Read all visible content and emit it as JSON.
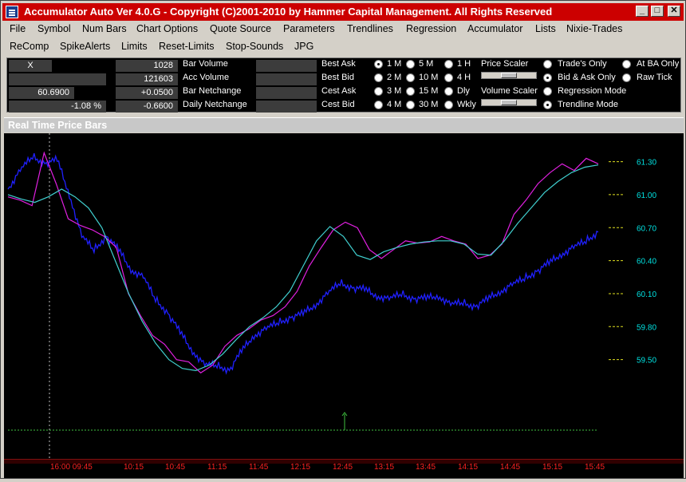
{
  "window": {
    "title": "Accumulator Auto Ver 4.0.G - Copyright (C)2001-2010 by Hammer Capital Management. All Rights Reserved"
  },
  "menu": {
    "row1": [
      "File",
      "Symbol",
      "Num Bars",
      "Chart Options",
      "Quote Source",
      "Parameters",
      "Trendlines",
      "Regression",
      "Accumulator",
      "Lists",
      "Nixie-Trades"
    ],
    "row2": [
      "ReComp",
      "SpikeAlerts",
      "Limits",
      "Reset-Limits",
      "Stop-Sounds",
      "JPG"
    ]
  },
  "panel": {
    "symbol_box": "X",
    "price_field": "60.6900",
    "pct_field": "-1.08 %",
    "bar_volume": "1028",
    "acc_volume": "121603",
    "bar_netchange": "+0.0500",
    "daily_netchange": "-0.6600",
    "labels": {
      "bar_volume": "Bar Volume",
      "acc_volume": "Acc Volume",
      "bar_netchange": "Bar Netchange",
      "daily_netchange": "Daily Netchange",
      "best_ask": "Best Ask",
      "best_bid": "Best Bid",
      "cest_ask": "Cest Ask",
      "cest_bid": "Cest Bid"
    },
    "timeframes": [
      {
        "label": "1 M",
        "selected": true
      },
      {
        "label": "5 M",
        "selected": false
      },
      {
        "label": "1 H",
        "selected": false
      },
      {
        "label": "2 M",
        "selected": false
      },
      {
        "label": "10 M",
        "selected": false
      },
      {
        "label": "4 H",
        "selected": false
      },
      {
        "label": "3 M",
        "selected": false
      },
      {
        "label": "15 M",
        "selected": false
      },
      {
        "label": "Dly",
        "selected": false
      },
      {
        "label": "4 M",
        "selected": false
      },
      {
        "label": "30 M",
        "selected": false
      },
      {
        "label": "Wkly",
        "selected": false
      }
    ],
    "price_scaler": "Price Scaler",
    "volume_scaler": "Volume Scaler",
    "modes": [
      {
        "label": "Trade's Only",
        "selected": false
      },
      {
        "label": "Bid & Ask Only",
        "selected": true
      },
      {
        "label": "Regression Mode",
        "selected": false
      },
      {
        "label": "Trendline Mode",
        "selected": true
      },
      {
        "label": "At BA Only",
        "selected": false
      },
      {
        "label": "Raw Tick",
        "selected": false
      }
    ]
  },
  "chart": {
    "title": "Real Time Price Bars",
    "colors": {
      "price": "#2020ff",
      "magenta": "#e020e0",
      "cyan": "#40d0d0",
      "volume": "#40c040",
      "yaxis": "#00e0e0",
      "xaxis": "#ff2020",
      "background": "#000000"
    }
  },
  "chart_data": {
    "type": "line",
    "ylim": [
      59.2,
      61.5
    ],
    "y_ticks": [
      "61.30",
      "61.00",
      "60.70",
      "60.40",
      "60.10",
      "59.80",
      "59.50"
    ],
    "x_ticks": [
      "16:00 09:45",
      "10:15",
      "10:45",
      "11:15",
      "11:45",
      "12:15",
      "12:45",
      "13:15",
      "13:45",
      "14:15",
      "14:45",
      "15:15",
      "15:45"
    ],
    "series": [
      {
        "values": [
          61.05,
          61.22,
          61.35,
          61.28,
          61.32,
          61.0,
          60.62,
          60.5,
          60.62,
          60.5,
          60.32,
          60.25,
          60.05,
          59.92,
          59.75,
          59.58,
          59.45,
          59.45,
          59.4,
          59.58,
          59.72,
          59.78,
          59.84,
          59.88,
          59.92,
          60.0,
          60.1,
          60.2,
          60.15,
          60.14,
          60.08,
          60.05,
          60.1,
          60.05,
          60.06,
          60.08,
          60.0,
          60.02,
          59.98,
          60.05,
          60.12,
          60.18,
          60.24,
          60.3,
          60.38,
          60.46,
          60.52,
          60.58,
          60.66
        ]
      },
      {
        "values": [
          60.98,
          60.95,
          60.9,
          61.38,
          61.1,
          60.78,
          60.72,
          60.68,
          60.62,
          60.52,
          60.1,
          59.9,
          59.72,
          59.64,
          59.5,
          59.48,
          59.38,
          59.45,
          59.62,
          59.72,
          59.78,
          59.86,
          59.9,
          59.98,
          60.12,
          60.35,
          60.52,
          60.68,
          60.75,
          60.7,
          60.5,
          60.42,
          60.5,
          60.58,
          60.56,
          60.57,
          60.62,
          60.58,
          60.55,
          60.42,
          60.45,
          60.55,
          60.82,
          60.95,
          61.1,
          61.2,
          61.28,
          61.22,
          61.33,
          61.28
        ]
      },
      {
        "values": [
          61.0,
          60.96,
          60.93,
          60.98,
          61.05,
          60.98,
          60.88,
          60.7,
          60.4,
          60.1,
          59.85,
          59.65,
          59.5,
          59.42,
          59.4,
          59.45,
          59.55,
          59.68,
          59.8,
          59.88,
          59.98,
          60.12,
          60.35,
          60.58,
          60.71,
          60.62,
          60.45,
          60.41,
          60.48,
          60.52,
          60.55,
          60.57,
          60.58,
          60.58,
          60.55,
          60.46,
          60.45,
          60.58,
          60.74,
          60.88,
          61.02,
          61.12,
          61.2,
          61.25,
          61.27
        ]
      }
    ]
  }
}
